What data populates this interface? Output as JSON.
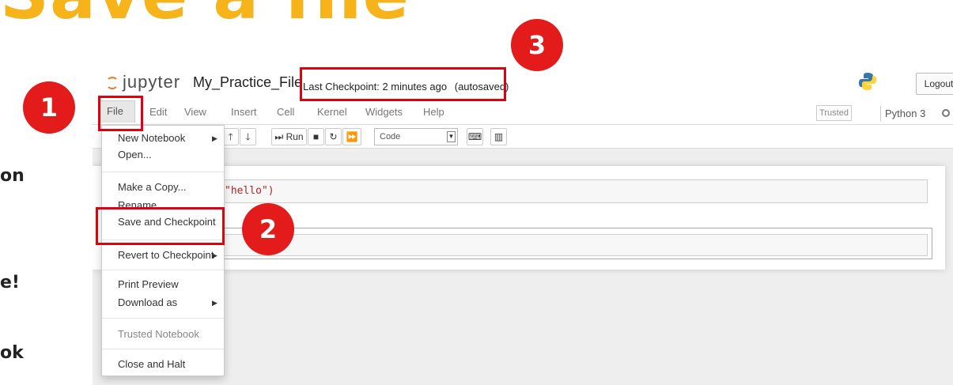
{
  "slide": {
    "title": "Save a file",
    "side_lines": [
      "on",
      "e!",
      "ok"
    ]
  },
  "header": {
    "logo_text": "jupyter",
    "notebook_name": "My_Practice_File",
    "checkpoint": "Last Checkpoint: 2 minutes ago",
    "autosave": "(autosaved)",
    "logout": "Logout"
  },
  "menu": {
    "items": [
      "File",
      "Edit",
      "View",
      "Insert",
      "Cell",
      "Kernel",
      "Widgets",
      "Help"
    ],
    "trusted": "Trusted",
    "kernel": "Python 3"
  },
  "toolbar": {
    "run": "Run",
    "cell_type": "Code"
  },
  "cells": {
    "code_1": "\"hello\")"
  },
  "file_menu": {
    "new_notebook": "New Notebook",
    "open": "Open...",
    "make_copy": "Make a Copy...",
    "rename": "Rename...",
    "save_checkpoint": "Save and Checkpoint",
    "revert": "Revert to Checkpoint",
    "print_preview": "Print Preview",
    "download_as": "Download as",
    "trusted_notebook": "Trusted Notebook",
    "close_halt": "Close and Halt"
  },
  "annotations": {
    "step1": "1",
    "step2": "2",
    "step3": "3",
    "highlight_color": "#e0000e",
    "title_color": "#f6b31a"
  }
}
